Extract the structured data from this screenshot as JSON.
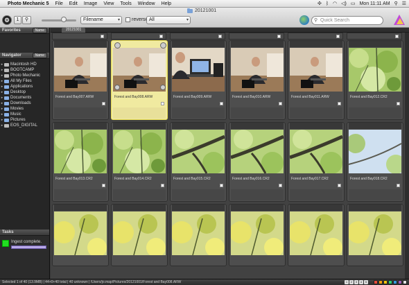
{
  "menubar": {
    "apple": "",
    "app_name": "Photo Mechanic 5",
    "items": [
      "File",
      "Edit",
      "Image",
      "View",
      "Tools",
      "Window",
      "Help"
    ],
    "clock": "Mon 11:11 AM"
  },
  "window": {
    "title": "20121001"
  },
  "toolbar": {
    "thumb_size_value": "1",
    "sort_select": "Filename",
    "reverse_label": "reverse",
    "filter_select": "All",
    "search_placeholder": "Quick Search"
  },
  "sidebar": {
    "favorites_title": "Favorites",
    "favorites_button": "Name",
    "navigator_title": "Navigator",
    "navigator_button": "Name",
    "nav_items": [
      {
        "label": "Macintosh HD",
        "type": "drive",
        "expanded": false
      },
      {
        "label": "BOOTCAMP",
        "type": "drive",
        "expanded": false
      },
      {
        "label": "Photo Mechanic",
        "type": "drive",
        "expanded": false
      },
      {
        "label": "All My Files",
        "type": "folder",
        "expanded": false
      },
      {
        "label": "Applications",
        "type": "folder",
        "expanded": false
      },
      {
        "label": "Desktop",
        "type": "folder",
        "expanded": false
      },
      {
        "label": "Documents",
        "type": "folder",
        "expanded": false
      },
      {
        "label": "Downloads",
        "type": "folder",
        "expanded": false
      },
      {
        "label": "Movies",
        "type": "folder",
        "expanded": false
      },
      {
        "label": "Music",
        "type": "folder",
        "expanded": false
      },
      {
        "label": "Pictures",
        "type": "folder",
        "expanded": false
      },
      {
        "label": "EOS_DIGITAL",
        "type": "drive",
        "expanded": false
      }
    ],
    "tasks_title": "Tasks",
    "task_label": "Ingest complete."
  },
  "tab": {
    "label": "20121001"
  },
  "cells": [
    {
      "filename": "Forest and Bay007.ARW",
      "kind": "person",
      "selected": false
    },
    {
      "filename": "Forest and Bay008.ARW",
      "kind": "person",
      "selected": true
    },
    {
      "filename": "Forest and Bay009.ARW",
      "kind": "laptop",
      "selected": false
    },
    {
      "filename": "Forest and Bay010.ARW",
      "kind": "person",
      "selected": false
    },
    {
      "filename": "Forest and Bay011.ARW",
      "kind": "person",
      "selected": false
    },
    {
      "filename": "Forest and Bay012.CR2",
      "kind": "leaves",
      "selected": false
    },
    {
      "filename": "Forest and Bay013.CR2",
      "kind": "leaves",
      "selected": false
    },
    {
      "filename": "Forest and Bay014.CR2",
      "kind": "leaves",
      "selected": false
    },
    {
      "filename": "Forest and Bay015.CR2",
      "kind": "branch",
      "selected": false
    },
    {
      "filename": "Forest and Bay016.CR2",
      "kind": "branch",
      "selected": false
    },
    {
      "filename": "Forest and Bay017.CR2",
      "kind": "branch",
      "selected": false
    },
    {
      "filename": "Forest and Bay018.CR2",
      "kind": "sky",
      "selected": false
    },
    {
      "filename": "",
      "kind": "yellow",
      "selected": false
    },
    {
      "filename": "",
      "kind": "yellow",
      "selected": false
    },
    {
      "filename": "",
      "kind": "yellow",
      "selected": false
    },
    {
      "filename": "",
      "kind": "yellow",
      "selected": false
    },
    {
      "filename": "",
      "kind": "yellow",
      "selected": false
    },
    {
      "filename": "",
      "kind": "yellow",
      "selected": false
    }
  ],
  "statusbar": {
    "text": "Selected 1 of 40 (13.9MB) | 44+0+40 total | 40 unknown | /Users/jo.map/Pictures/20121001/Forest and Bay008.ARW",
    "pages": [
      "1",
      "2",
      "3",
      "4",
      "5"
    ]
  },
  "colors": {
    "selected_cell": "#f0eaa0",
    "task_green": "#22dd22",
    "label_swatches": [
      "#e74c3c",
      "#f39c12",
      "#f1c40f",
      "#2ecc71",
      "#3498db",
      "#9b59b6",
      "#e0e0e0"
    ]
  }
}
